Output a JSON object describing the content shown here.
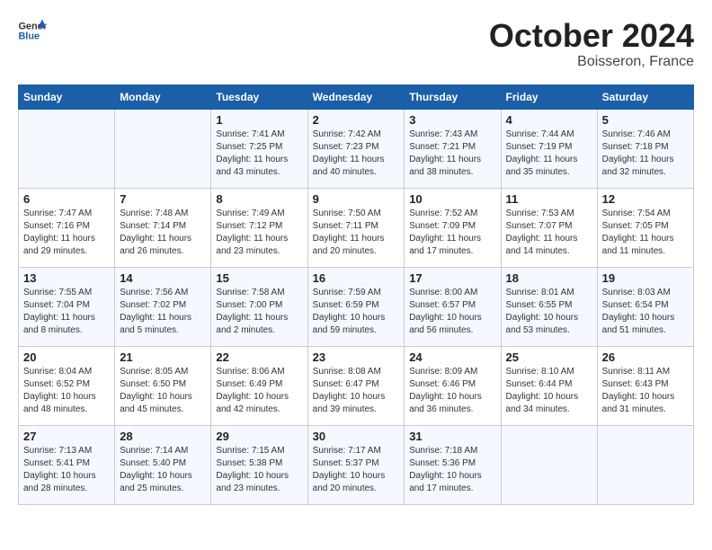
{
  "header": {
    "logo_line1": "General",
    "logo_line2": "Blue",
    "month": "October 2024",
    "location": "Boisseron, France"
  },
  "weekdays": [
    "Sunday",
    "Monday",
    "Tuesday",
    "Wednesday",
    "Thursday",
    "Friday",
    "Saturday"
  ],
  "weeks": [
    [
      {
        "day": "",
        "info": ""
      },
      {
        "day": "",
        "info": ""
      },
      {
        "day": "1",
        "info": "Sunrise: 7:41 AM\nSunset: 7:25 PM\nDaylight: 11 hours and 43 minutes."
      },
      {
        "day": "2",
        "info": "Sunrise: 7:42 AM\nSunset: 7:23 PM\nDaylight: 11 hours and 40 minutes."
      },
      {
        "day": "3",
        "info": "Sunrise: 7:43 AM\nSunset: 7:21 PM\nDaylight: 11 hours and 38 minutes."
      },
      {
        "day": "4",
        "info": "Sunrise: 7:44 AM\nSunset: 7:19 PM\nDaylight: 11 hours and 35 minutes."
      },
      {
        "day": "5",
        "info": "Sunrise: 7:46 AM\nSunset: 7:18 PM\nDaylight: 11 hours and 32 minutes."
      }
    ],
    [
      {
        "day": "6",
        "info": "Sunrise: 7:47 AM\nSunset: 7:16 PM\nDaylight: 11 hours and 29 minutes."
      },
      {
        "day": "7",
        "info": "Sunrise: 7:48 AM\nSunset: 7:14 PM\nDaylight: 11 hours and 26 minutes."
      },
      {
        "day": "8",
        "info": "Sunrise: 7:49 AM\nSunset: 7:12 PM\nDaylight: 11 hours and 23 minutes."
      },
      {
        "day": "9",
        "info": "Sunrise: 7:50 AM\nSunset: 7:11 PM\nDaylight: 11 hours and 20 minutes."
      },
      {
        "day": "10",
        "info": "Sunrise: 7:52 AM\nSunset: 7:09 PM\nDaylight: 11 hours and 17 minutes."
      },
      {
        "day": "11",
        "info": "Sunrise: 7:53 AM\nSunset: 7:07 PM\nDaylight: 11 hours and 14 minutes."
      },
      {
        "day": "12",
        "info": "Sunrise: 7:54 AM\nSunset: 7:05 PM\nDaylight: 11 hours and 11 minutes."
      }
    ],
    [
      {
        "day": "13",
        "info": "Sunrise: 7:55 AM\nSunset: 7:04 PM\nDaylight: 11 hours and 8 minutes."
      },
      {
        "day": "14",
        "info": "Sunrise: 7:56 AM\nSunset: 7:02 PM\nDaylight: 11 hours and 5 minutes."
      },
      {
        "day": "15",
        "info": "Sunrise: 7:58 AM\nSunset: 7:00 PM\nDaylight: 11 hours and 2 minutes."
      },
      {
        "day": "16",
        "info": "Sunrise: 7:59 AM\nSunset: 6:59 PM\nDaylight: 10 hours and 59 minutes."
      },
      {
        "day": "17",
        "info": "Sunrise: 8:00 AM\nSunset: 6:57 PM\nDaylight: 10 hours and 56 minutes."
      },
      {
        "day": "18",
        "info": "Sunrise: 8:01 AM\nSunset: 6:55 PM\nDaylight: 10 hours and 53 minutes."
      },
      {
        "day": "19",
        "info": "Sunrise: 8:03 AM\nSunset: 6:54 PM\nDaylight: 10 hours and 51 minutes."
      }
    ],
    [
      {
        "day": "20",
        "info": "Sunrise: 8:04 AM\nSunset: 6:52 PM\nDaylight: 10 hours and 48 minutes."
      },
      {
        "day": "21",
        "info": "Sunrise: 8:05 AM\nSunset: 6:50 PM\nDaylight: 10 hours and 45 minutes."
      },
      {
        "day": "22",
        "info": "Sunrise: 8:06 AM\nSunset: 6:49 PM\nDaylight: 10 hours and 42 minutes."
      },
      {
        "day": "23",
        "info": "Sunrise: 8:08 AM\nSunset: 6:47 PM\nDaylight: 10 hours and 39 minutes."
      },
      {
        "day": "24",
        "info": "Sunrise: 8:09 AM\nSunset: 6:46 PM\nDaylight: 10 hours and 36 minutes."
      },
      {
        "day": "25",
        "info": "Sunrise: 8:10 AM\nSunset: 6:44 PM\nDaylight: 10 hours and 34 minutes."
      },
      {
        "day": "26",
        "info": "Sunrise: 8:11 AM\nSunset: 6:43 PM\nDaylight: 10 hours and 31 minutes."
      }
    ],
    [
      {
        "day": "27",
        "info": "Sunrise: 7:13 AM\nSunset: 5:41 PM\nDaylight: 10 hours and 28 minutes."
      },
      {
        "day": "28",
        "info": "Sunrise: 7:14 AM\nSunset: 5:40 PM\nDaylight: 10 hours and 25 minutes."
      },
      {
        "day": "29",
        "info": "Sunrise: 7:15 AM\nSunset: 5:38 PM\nDaylight: 10 hours and 23 minutes."
      },
      {
        "day": "30",
        "info": "Sunrise: 7:17 AM\nSunset: 5:37 PM\nDaylight: 10 hours and 20 minutes."
      },
      {
        "day": "31",
        "info": "Sunrise: 7:18 AM\nSunset: 5:36 PM\nDaylight: 10 hours and 17 minutes."
      },
      {
        "day": "",
        "info": ""
      },
      {
        "day": "",
        "info": ""
      }
    ]
  ]
}
